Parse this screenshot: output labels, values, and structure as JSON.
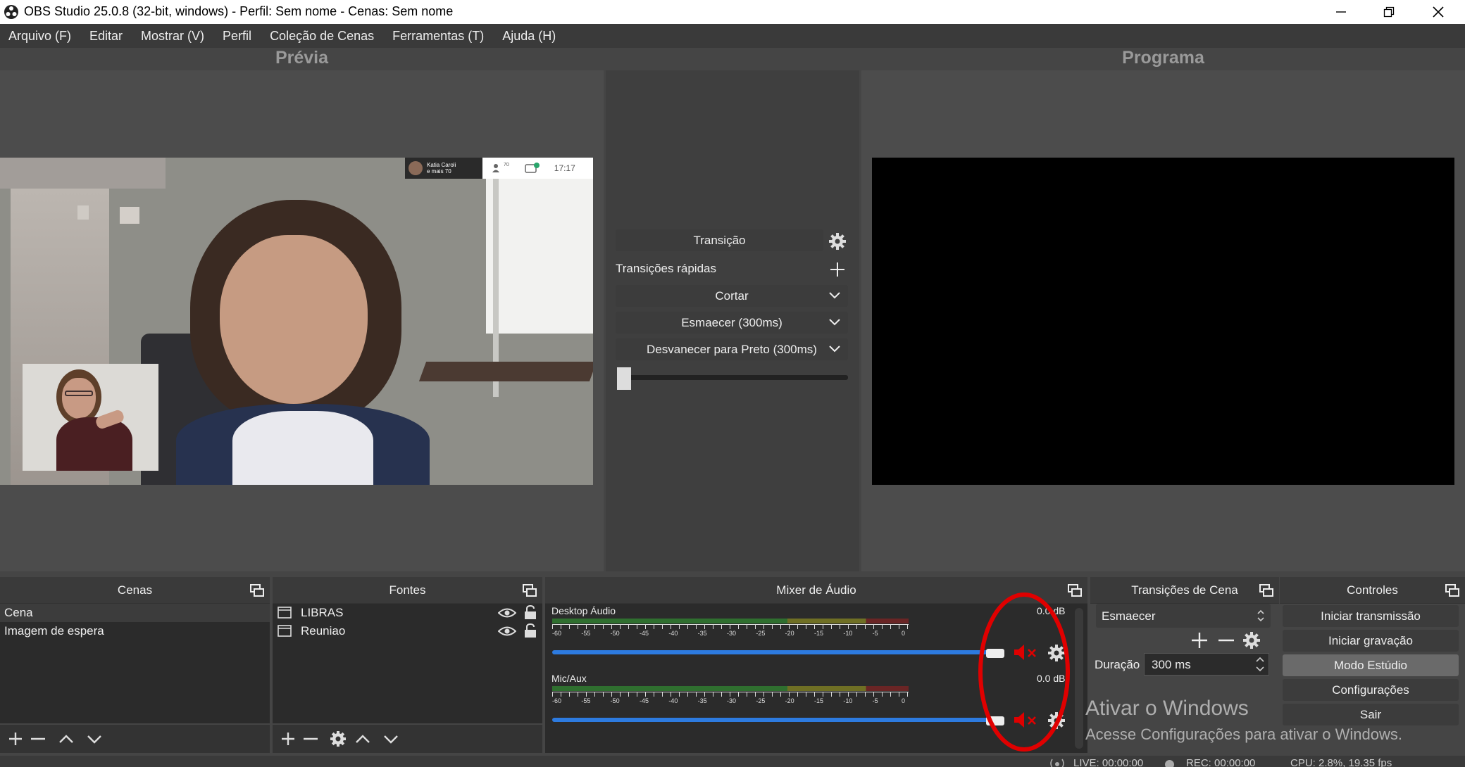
{
  "window": {
    "title": "OBS Studio 25.0.8 (32-bit, windows) - Perfil: Sem nome - Cenas: Sem nome"
  },
  "menu": [
    "Arquivo (F)",
    "Editar",
    "Mostrar (V)",
    "Perfil",
    "Coleção de Cenas",
    "Ferramentas (T)",
    "Ajuda (H)"
  ],
  "preview": {
    "title": "Prévia",
    "meeting": {
      "participant": "Katia Caroli",
      "participant_sub": "e mais 70",
      "count": "70",
      "time": "17:17"
    }
  },
  "program": {
    "title": "Programa"
  },
  "transition_panel": {
    "transition_button": "Transição",
    "quick_label": "Transições rápidas",
    "options": [
      "Cortar",
      "Esmaecer (300ms)",
      "Desvanecer para Preto (300ms)"
    ],
    "tbar_value": 0
  },
  "docks": {
    "scenes": "Cenas",
    "sources": "Fontes",
    "mixer": "Mixer de Áudio",
    "transitions": "Transições de Cena",
    "controls": "Controles"
  },
  "scenes": [
    "Cena",
    "Imagem de espera"
  ],
  "sources": [
    "LIBRAS",
    "Reuniao"
  ],
  "mixer": {
    "channels": [
      {
        "name": "Desktop Áudio",
        "db": "0.0 dB",
        "volume": 1.0,
        "muted": true
      },
      {
        "name": "Mic/Aux",
        "db": "0.0 dB",
        "volume": 1.0,
        "muted": true
      }
    ],
    "scale": [
      "-60",
      "-55",
      "-50",
      "-45",
      "-40",
      "-35",
      "-30",
      "-25",
      "-20",
      "-15",
      "-10",
      "-5",
      "0"
    ]
  },
  "scene_transitions": {
    "selected": "Esmaecer",
    "duration_label": "Duração",
    "duration": "300 ms"
  },
  "controls": [
    "Iniciar transmissão",
    "Iniciar gravação",
    "Modo Estúdio",
    "Configurações",
    "Sair"
  ],
  "watermark": {
    "line1": "Ativar o Windows",
    "line2": "Acesse Configurações para ativar o Windows."
  },
  "statusbar": {
    "live": "LIVE: 00:00:00",
    "rec": "REC: 00:00:00",
    "cpu": "CPU: 2.8%, 19.35 fps"
  },
  "colors": {
    "highlight": "#e00000",
    "accent": "#2d7be0",
    "background": "#454545"
  }
}
